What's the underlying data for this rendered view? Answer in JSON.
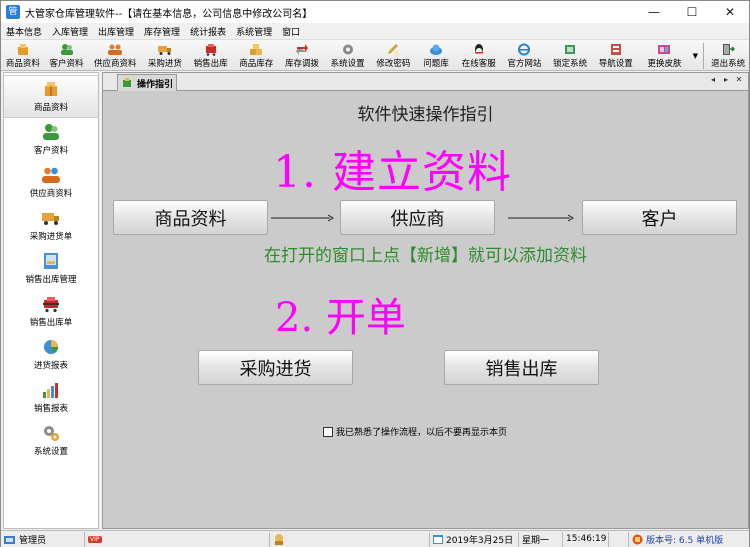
{
  "window": {
    "app_icon": "管",
    "title": "大管家仓库管理软件--【请在基本信息，公司信息中修改公司名】",
    "minimize": "—",
    "maximize": "☐",
    "close": "✕"
  },
  "menu": [
    "基本信息",
    "入库管理",
    "出库管理",
    "库存管理",
    "统计报表",
    "系统管理",
    "窗口"
  ],
  "toolbar": [
    {
      "label": "商品资料",
      "icon": "products-icon",
      "color": "#e89b2b"
    },
    {
      "label": "客户资料",
      "icon": "customers-icon",
      "color": "#3c9a3c"
    },
    {
      "label": "供应商资料",
      "icon": "suppliers-icon",
      "color": "#e07c2c"
    },
    {
      "label": "采购进货",
      "icon": "truck-icon",
      "color": "#e6a23c"
    },
    {
      "label": "销售出库",
      "icon": "cart-icon",
      "color": "#cc2a2a"
    },
    {
      "label": "商品库存",
      "icon": "stock-icon",
      "color": "#d9a12e"
    },
    {
      "label": "库存调拨",
      "icon": "transfer-icon",
      "color": "#c83030"
    },
    {
      "label": "系统设置",
      "icon": "settings-icon",
      "color": "#8a8a8a"
    },
    {
      "label": "修改密码",
      "icon": "pencil-icon",
      "color": "#c9a542"
    },
    {
      "label": "问题库",
      "icon": "cloud-icon",
      "color": "#3a8fd8"
    },
    {
      "label": "在线客服",
      "icon": "qq-icon",
      "color": "#222222"
    },
    {
      "label": "官方网站",
      "icon": "ie-icon",
      "color": "#2c7fd6"
    },
    {
      "label": "锁定系统",
      "icon": "lock-icon",
      "color": "#3a9a5a"
    },
    {
      "label": "导航设置",
      "icon": "nav-settings-icon",
      "color": "#c05050"
    },
    {
      "label": "更换皮肤",
      "icon": "skin-icon",
      "color": "#d04a8a"
    },
    {
      "label": "退出系统",
      "icon": "exit-icon",
      "color": "#555555"
    }
  ],
  "nav": [
    {
      "label": "商品资料",
      "icon": "products-icon",
      "color": "#e89b2b"
    },
    {
      "label": "客户资料",
      "icon": "customers-icon",
      "color": "#3c9a3c"
    },
    {
      "label": "供应商资料",
      "icon": "suppliers-icon",
      "color": "#e07c2c"
    },
    {
      "label": "采购进货单",
      "icon": "truck-icon",
      "color": "#e6a23c"
    },
    {
      "label": "销售出库管理",
      "icon": "sales-manage-icon",
      "color": "#4a8fd6"
    },
    {
      "label": "销售出库单",
      "icon": "cart-icon",
      "color": "#cc2a2a"
    },
    {
      "label": "进货报表",
      "icon": "pie-chart-icon",
      "color": "#3a8fd8"
    },
    {
      "label": "销售报表",
      "icon": "bar-chart-icon",
      "color": "#3a9a3a"
    },
    {
      "label": "系统设置",
      "icon": "settings-icon",
      "color": "#8a8a8a"
    }
  ],
  "tab": {
    "label": "操作指引",
    "prev": "◂",
    "next": "▸",
    "close": "✕"
  },
  "guide": {
    "title": "软件快速操作指引",
    "step1": "1. 建立资料",
    "buttons1": [
      "商品资料",
      "供应商",
      "客户"
    ],
    "hint": "在打开的窗口上点【新增】就可以添加资料",
    "step2": "2. 开单",
    "buttons2": [
      "采购进货",
      "销售出库"
    ],
    "checkbox_label": "我已熟悉了操作流程，以后不要再显示本页",
    "checkbox_checked": false
  },
  "status": {
    "user": "管理员",
    "vip": "VIP",
    "date": "2019年3月25日",
    "weekday": "星期一",
    "time": "15:46:19",
    "version": "版本号: 6.5 单机版"
  },
  "colors": {
    "accent_magenta": "#ff00ff",
    "hint_green": "#2e8b2e",
    "version_blue": "#1f3fbf"
  }
}
